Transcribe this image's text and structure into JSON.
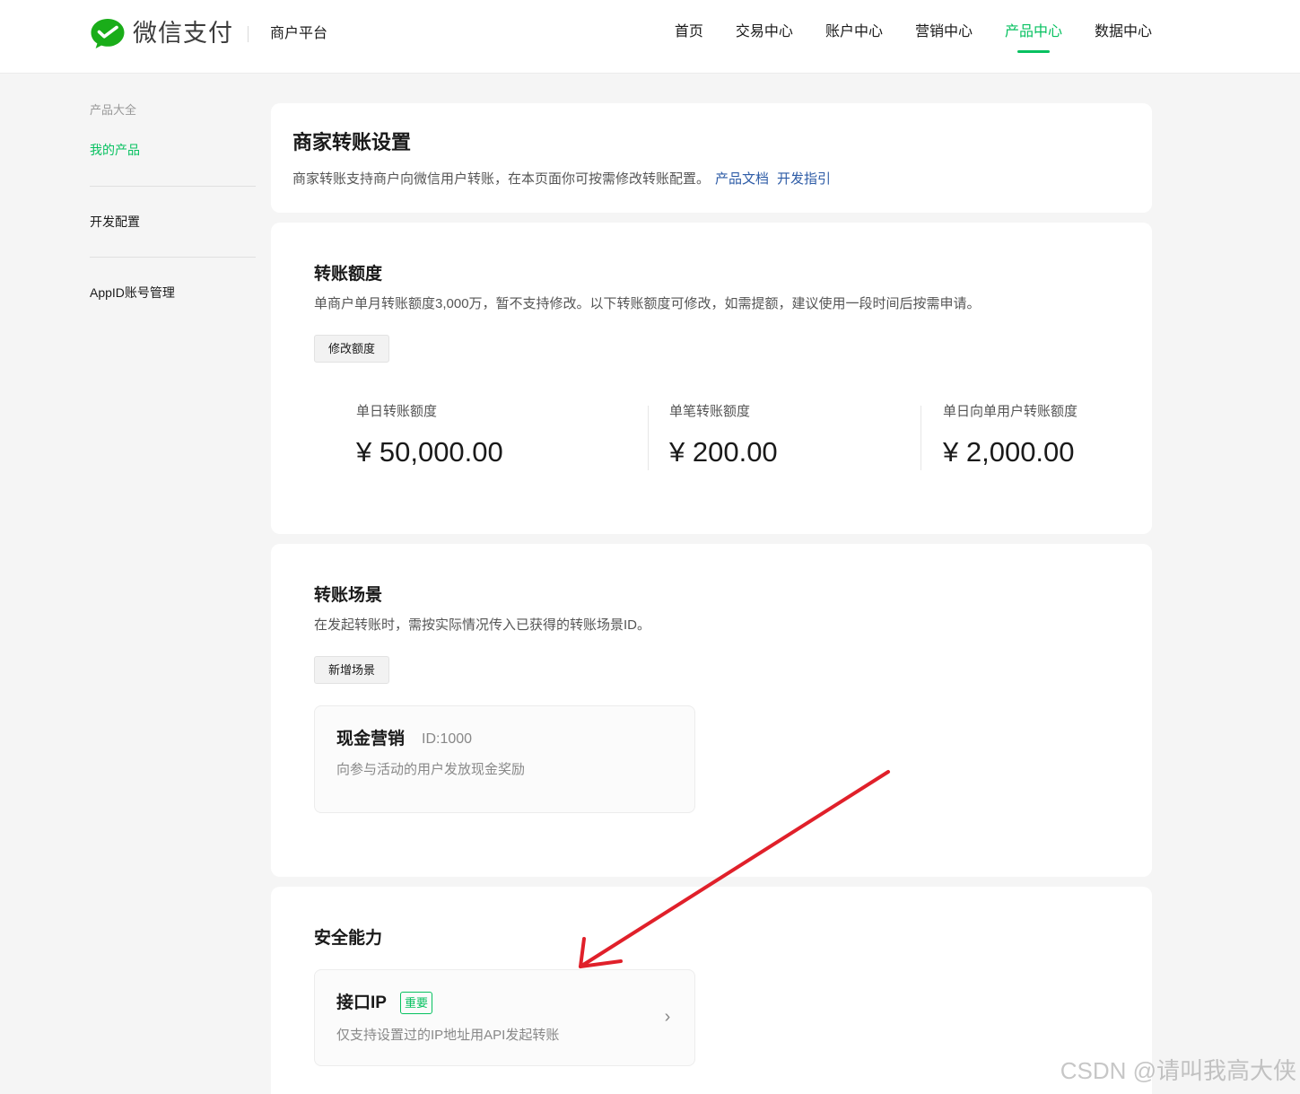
{
  "header": {
    "logo_icon": "wechat-pay-logo",
    "brand": "微信支付",
    "platform": "商户平台",
    "nav": [
      "首页",
      "交易中心",
      "账户中心",
      "营销中心",
      "产品中心",
      "数据中心"
    ],
    "active_nav": "产品中心"
  },
  "sidebar": {
    "group_label": "产品大全",
    "items": [
      "我的产品",
      "开发配置",
      "AppID账号管理"
    ],
    "active_item": "我的产品"
  },
  "page": {
    "title": "商家转账设置",
    "desc": "商家转账支持商户向微信用户转账，在本页面你可按需修改转账配置。",
    "links": [
      "产品文档",
      "开发指引"
    ]
  },
  "quota": {
    "title": "转账额度",
    "desc": "单商户单月转账额度3,000万，暂不支持修改。以下转账额度可修改，如需提额，建议使用一段时间后按需申请。",
    "button": "修改额度",
    "stats": [
      {
        "label": "单日转账额度",
        "value": "¥ 50,000.00"
      },
      {
        "label": "单笔转账额度",
        "value": "¥ 200.00"
      },
      {
        "label": "单日向单用户转账额度",
        "value": "¥ 2,000.00"
      }
    ]
  },
  "scene": {
    "title": "转账场景",
    "desc": "在发起转账时，需按实际情况传入已获得的转账场景ID。",
    "button": "新增场景",
    "card": {
      "title": "现金营销",
      "id": "ID:1000",
      "desc": "向参与活动的用户发放现金奖励"
    }
  },
  "security": {
    "title": "安全能力",
    "card": {
      "title": "接口IP",
      "badge": "重要",
      "desc": "仅支持设置过的IP地址用API发起转账",
      "icon": "chevron-right-icon"
    }
  },
  "colors": {
    "accent": "#07c160",
    "link": "#2d5ba6",
    "annotation": "#e0202a"
  },
  "watermark": "CSDN @请叫我高大侠"
}
